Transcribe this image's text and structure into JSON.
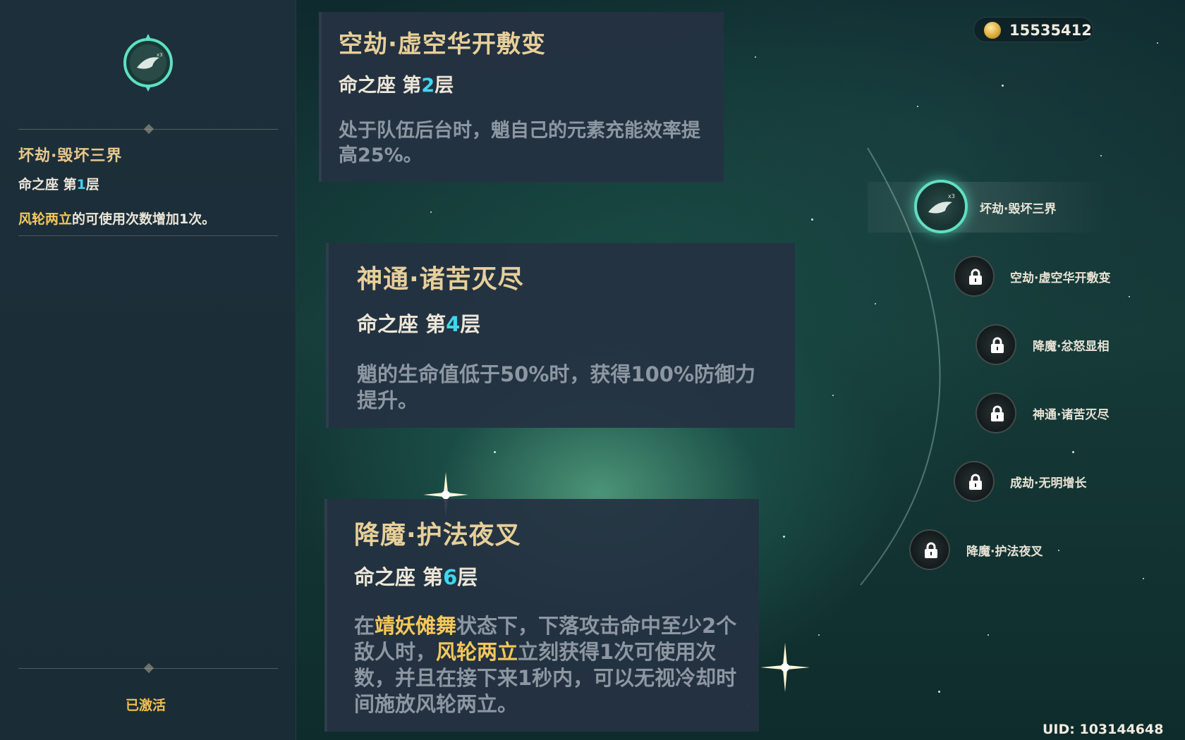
{
  "currency": {
    "icon": "primogem-coin-icon",
    "value": "15535412"
  },
  "left_panel": {
    "title": "坏劫·毁坏三界",
    "level_prefix": "命之座 第",
    "level_num": "1",
    "level_suffix": "层",
    "desc_highlight": "风轮两立",
    "desc_rest": "的可使用次数增加1次。",
    "status": "已激活"
  },
  "cards": [
    {
      "title": "空劫·虚空华开敷变",
      "level_prefix": "命之座 第",
      "level_num": "2",
      "level_suffix": "层",
      "desc": "处于队伍后台时，魈自己的元素充能效率提高25%。"
    },
    {
      "title": "神通·诸苦灭尽",
      "level_prefix": "命之座 第",
      "level_num": "4",
      "level_suffix": "层",
      "desc": "魈的生命值低于50%时，获得100%防御力提升。"
    },
    {
      "title": "降魔·护法夜叉",
      "level_prefix": "命之座 第",
      "level_num": "6",
      "level_suffix": "层",
      "desc_p1": "在",
      "desc_h1": "靖妖傩舞",
      "desc_p2": "状态下，下落攻击命中至少2个敌人时，",
      "desc_h2": "风轮两立",
      "desc_p3": "立刻获得1次可使用次数，并且在接下来1秒内，可以无视冷却时间施放风轮两立。"
    }
  ],
  "constellation": [
    {
      "label": "坏劫·毁坏三界",
      "state": "active"
    },
    {
      "label": "空劫·虚空华开敷变",
      "state": "locked"
    },
    {
      "label": "降魔·忿怒显相",
      "state": "locked"
    },
    {
      "label": "神通·诸苦灭尽",
      "state": "locked"
    },
    {
      "label": "成劫·无明增长",
      "state": "locked"
    },
    {
      "label": "降魔·护法夜叉",
      "state": "locked"
    }
  ],
  "uid": "UID: 103144648",
  "colors": {
    "accent_gold": "#e9c98a",
    "highlight_yellow": "#f3c85a",
    "number_cyan": "#3fd6f0",
    "active_teal": "#5fe0c3"
  }
}
